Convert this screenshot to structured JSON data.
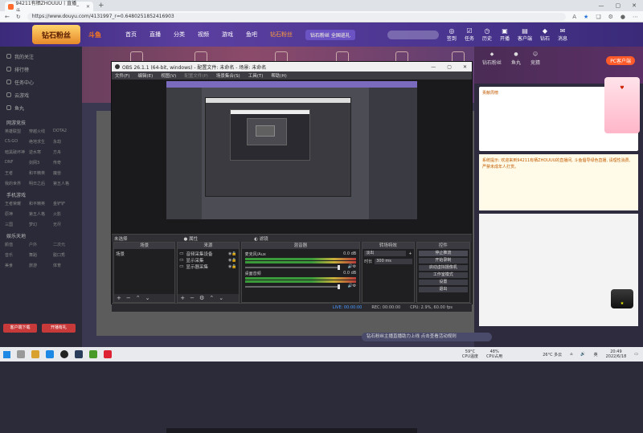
{
  "browser": {
    "tab_title": "94211有栖ZHOUUU丨直播_斗...",
    "url": "https://www.douyu.com/4131997_r=0.6480251852416903",
    "new_tab": "+",
    "win_controls": [
      "—",
      "▢",
      "✕"
    ]
  },
  "site_header": {
    "logo_text": "钻石粉丝",
    "brand": "斗鱼",
    "nav": [
      "首页",
      "直播",
      "分类",
      "视频",
      "游戏",
      "鱼吧",
      "钻石粉丝"
    ],
    "promo": "钻石粉丝 全国巡礼",
    "search_placeholder": "",
    "icons": [
      "签到",
      "任务",
      "历史",
      "开播",
      "客户端",
      "钻石",
      "消息"
    ]
  },
  "sidebar": {
    "items": [
      "我的关注",
      "排行榜",
      "任务中心",
      "云游戏",
      "鱼丸"
    ],
    "section1": "网游竞技",
    "section1_grid": [
      "英雄联盟",
      "穿越火线",
      "DOTA2",
      "CS:GO",
      "绝地求生",
      "永劫",
      "暗黑破坏神",
      "逆水寒",
      "方舟",
      "DNF",
      "剑网3",
      "传奇",
      "王者",
      "和平精英",
      "魔兽",
      "我的世界",
      "明日之后",
      "第五人格"
    ],
    "section2": "手机游戏",
    "section2_grid": [
      "王者荣耀",
      "和平精英",
      "金铲铲",
      "原神",
      "第五人格",
      "火影",
      "三国",
      "梦幻",
      "无尽"
    ],
    "section3": "娱乐天地",
    "section3_grid": [
      "颜值",
      "户外",
      "二次元",
      "音乐",
      "舞蹈",
      "脱口秀",
      "美食",
      "旅游",
      "体育"
    ],
    "btn1": "客户端下载",
    "btn2": "开播有礼"
  },
  "obs": {
    "title": "OBS 26.1.1 (64-bit, windows) - 配置文件: 未命名 - 场景: 未命名",
    "menu": [
      "文件(F)",
      "编辑(E)",
      "视图(V)",
      "配置文件(P)",
      "场景集合(S)",
      "工具(T)",
      "帮助(H)"
    ],
    "scene_label": "未选择",
    "scene_ctrl": [
      "● 属性",
      "◐ 滤镜"
    ],
    "docks": {
      "scenes_title": "场景",
      "scenes": [
        "场景"
      ],
      "sources_title": "来源",
      "sources": [
        "音频采集设备",
        "显示采集",
        "显示器采集"
      ],
      "mixer_title": "混音器",
      "mixer": [
        {
          "name": "麦克风/Aux",
          "db": "0.0 dB"
        },
        {
          "name": "桌面音频",
          "db": "0.0 dB"
        }
      ],
      "transitions_title": "转场特效",
      "transition": "淡出",
      "duration_label": "时长",
      "duration": "300 ms",
      "controls_title": "控件",
      "controls": [
        "停止推流",
        "开始录制",
        "启动虚拟摄像机",
        "工作室模式",
        "设置",
        "退出"
      ]
    },
    "status": {
      "live": "LIVE: 00:00:00",
      "rec": "REC: 00:00:00",
      "cpu": "CPU: 2.9%, 60.00 fps"
    }
  },
  "right_side": {
    "icons": [
      "钻石粉丝",
      "鱼丸",
      "竞猜"
    ],
    "pc_btn": "PC客户端",
    "panel_title": "贡献周榜",
    "chat": "系统提示: 欢迎来到94211有栖ZHOUUU的直播间, 斗鱼倡导绿色直播, 请理性消费, 严禁未成年人打赏。"
  },
  "noticebar": "钻石粉丝主播直播助力上线  点击查看活动规则",
  "taskbar": {
    "weather": "26°C 多云",
    "cpu_temp": "59°C",
    "cpu_label": "CPU温度",
    "cpu_use": "48%",
    "cpu_use_label": "CPU占用",
    "time": "20:49",
    "date": "2022/6/18",
    "lang": "英"
  },
  "colors": {
    "accent": "#ff7a1a",
    "obs_bg": "#2a2a2e",
    "site_purple": "#5b3fa0"
  }
}
